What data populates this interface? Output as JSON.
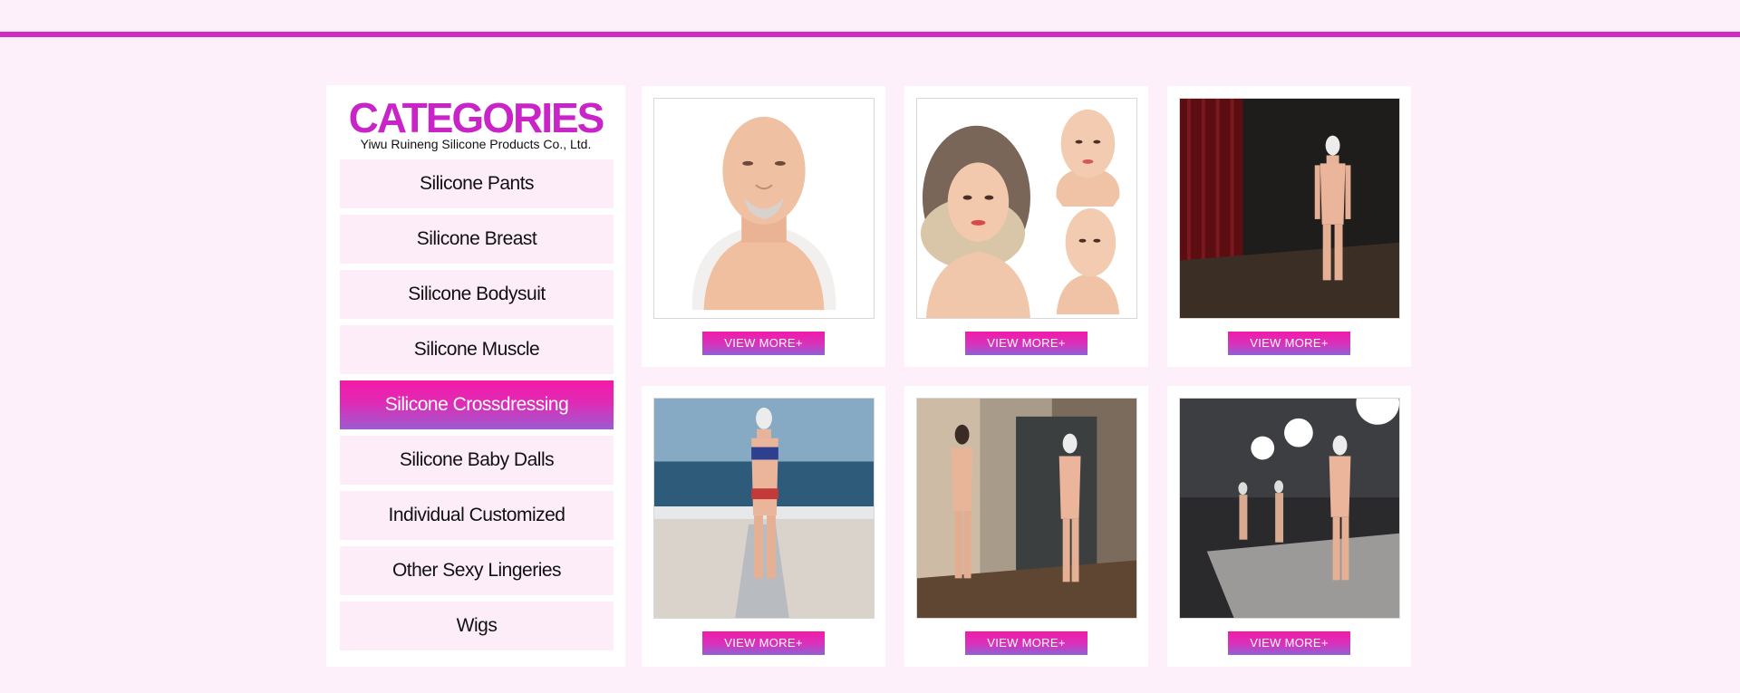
{
  "header": {
    "accent_color": "#d02cc0"
  },
  "categories": {
    "title": "CATEGORIES",
    "company": "Yiwu Ruineng Silicone Products Co., Ltd.",
    "items": [
      {
        "label": "Silicone Pants",
        "active": false
      },
      {
        "label": "Silicone Breast",
        "active": false
      },
      {
        "label": "Silicone Bodysuit",
        "active": false
      },
      {
        "label": "Silicone Muscle",
        "active": false
      },
      {
        "label": "Silicone Crossdressing",
        "active": true
      },
      {
        "label": "Silicone Baby Dalls",
        "active": false
      },
      {
        "label": "Individual Customized",
        "active": false
      },
      {
        "label": "Other Sexy Lingeries",
        "active": false
      },
      {
        "label": "Wigs",
        "active": false
      }
    ]
  },
  "products": [
    {
      "image": "old-man-mask-photo",
      "button": "VIEW MORE+"
    },
    {
      "image": "female-mask-wig-photo",
      "button": "VIEW MORE+"
    },
    {
      "image": "bodysuit-stage-photo",
      "button": "VIEW MORE+"
    },
    {
      "image": "bodysuit-beach-photo",
      "button": "VIEW MORE+"
    },
    {
      "image": "bodysuit-room-photo",
      "button": "VIEW MORE+"
    },
    {
      "image": "bodysuit-showroom-photo",
      "button": "VIEW MORE+"
    }
  ],
  "colors": {
    "page_background": "#fdf0fb",
    "title": "#c824c8",
    "item_background": "#fcedf9",
    "active_gradient_top": "#f31aa5",
    "active_gradient_bottom": "#9c5cd0"
  }
}
